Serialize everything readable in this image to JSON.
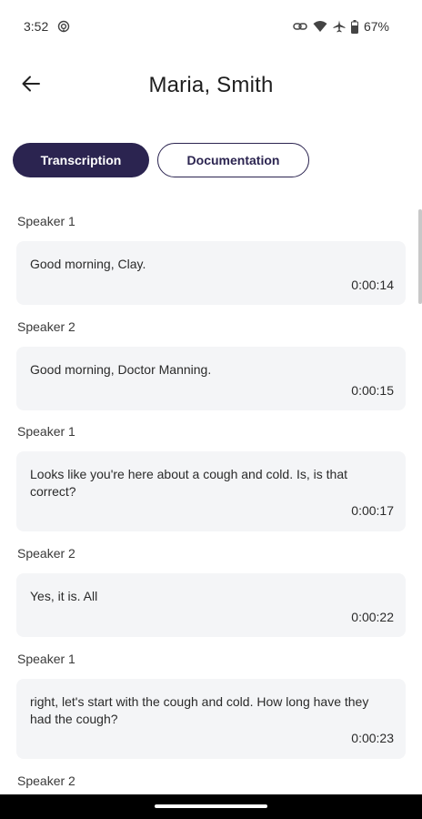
{
  "status_bar": {
    "time": "3:52",
    "battery_percent": "67%",
    "icons": [
      "hotspot-icon",
      "link-icon",
      "wifi-icon",
      "airplane-icon",
      "battery-icon"
    ]
  },
  "header": {
    "title": "Maria, Smith",
    "back_icon": "arrow-left-icon"
  },
  "tabs": [
    {
      "label": "Transcription",
      "active": true
    },
    {
      "label": "Documentation",
      "active": false
    }
  ],
  "transcript": [
    {
      "speaker": "Speaker 1",
      "text": "Good morning, Clay.",
      "time": "0:00:14"
    },
    {
      "speaker": "Speaker 2",
      "text": "Good morning, Doctor Manning.",
      "time": "0:00:15"
    },
    {
      "speaker": "Speaker 1",
      "text": "Looks like you're here about a cough and cold. Is, is that correct?",
      "time": "0:00:17"
    },
    {
      "speaker": "Speaker 2",
      "text": "Yes, it is. All",
      "time": "0:00:22"
    },
    {
      "speaker": "Speaker 1",
      "text": "right, let's start with the cough and cold. How long have they had the cough?",
      "time": "0:00:23"
    },
    {
      "speaker": "Speaker 2",
      "text": "",
      "time": ""
    }
  ],
  "colors": {
    "primary": "#2b2450",
    "bubble_bg": "#f4f5f7",
    "text": "#1f1f1f"
  }
}
